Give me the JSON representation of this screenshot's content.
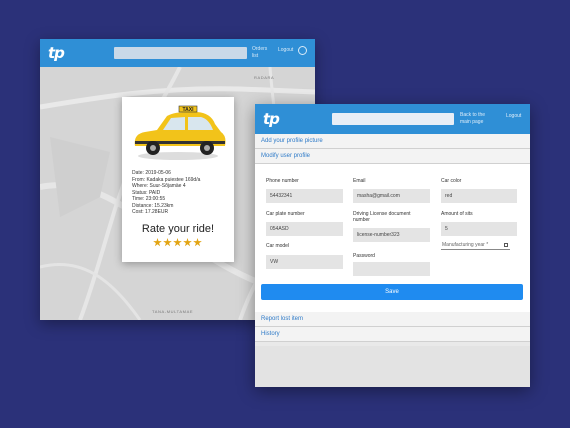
{
  "back_window": {
    "logo": "tp",
    "nav_link": [
      "Orders",
      "list"
    ],
    "logout": "Logout",
    "map": {
      "label_top": "RADARA",
      "label_bottom": "TANA-MULTAMAE"
    }
  },
  "ride_card": {
    "taxi_sign": "TAXI",
    "details": [
      "Date: 2019-05-06",
      "From: Kadaka puiestee 169d/a",
      "Where: Suur-Sõjamäe 4",
      "Status: PAID",
      "Time: 23:00:55",
      "Distance: 15.23km",
      "Cost: 17.28EUR"
    ],
    "rate_text": "Rate your ride!",
    "rating": 5,
    "colors": {
      "star": "#e2a413",
      "taxi": "#f2c31a"
    }
  },
  "front_window": {
    "logo": "tp",
    "back_link": [
      "Back to the",
      "main page"
    ],
    "logout": "Logout",
    "add_picture": "Add your profile picture",
    "modify_profile": "Modify user profile",
    "fields": {
      "phone": {
        "label": "Phone number",
        "value": "54432341"
      },
      "email": {
        "label": "Email",
        "value": "masha@gmail.com"
      },
      "car_color": {
        "label": "Car color",
        "value": "red"
      },
      "plate": {
        "label": "Car plate number",
        "value": "054ASD"
      },
      "license": {
        "label": [
          "Driving License document",
          "number"
        ],
        "value": "license-number323"
      },
      "seats": {
        "label": "Amount of sits",
        "value": "5"
      },
      "model": {
        "label": "Car model",
        "value": "VW"
      },
      "password": {
        "label": "Password",
        "value": ""
      },
      "manufacturing_year": {
        "placeholder": "Manufacturing year *"
      }
    },
    "save_label": "Save",
    "report_lost_item": "Report lost item",
    "history": "History",
    "colors": {
      "primary": "#1f8bf0",
      "header": "#2f8fd6",
      "link": "#2f7bc8"
    }
  }
}
